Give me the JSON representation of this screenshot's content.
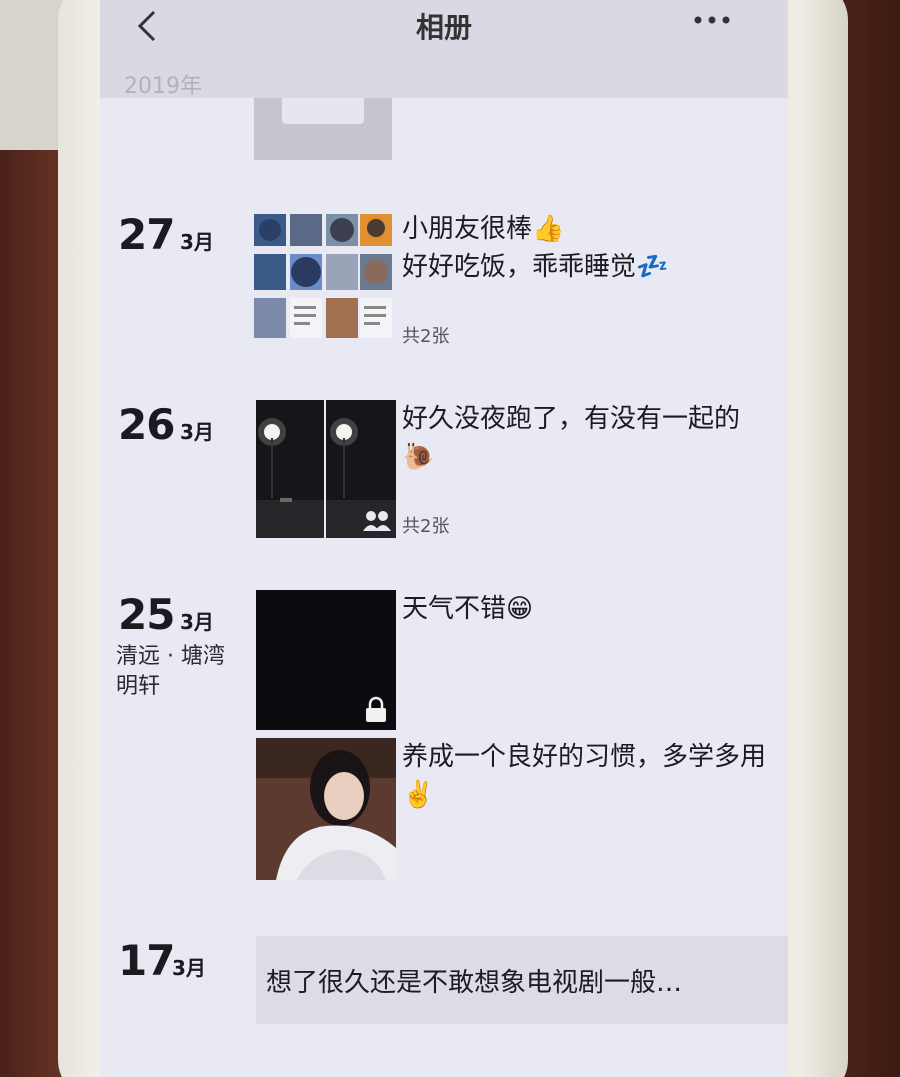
{
  "nav": {
    "back_icon": "chevron-left-icon",
    "title": "相册",
    "more_icon": "more-dots-icon"
  },
  "year_label": "2019年",
  "entries": [
    {
      "day": "27",
      "month": "3月",
      "text": "小朋友很棒👍\n好好吃饭，乖乖睡觉💤",
      "count": "共2张",
      "thumbnail": "photo-grid"
    },
    {
      "day": "26",
      "month": "3月",
      "text": "好久没夜跑了，有没有一起的🐌",
      "count": "共2张",
      "thumbnail": "night-street-photos"
    },
    {
      "day": "25",
      "month": "3月",
      "location": "清远 · 塘湾明轩",
      "posts": [
        {
          "text": "天气不错😁",
          "thumbnail": "dark-photo-locked"
        },
        {
          "text": "养成一个良好的习惯，多学多用✌️",
          "thumbnail": "selfie-photo"
        }
      ]
    },
    {
      "day": "17",
      "month": "3月",
      "text": "想了很久还是不敢想象电视剧一般…"
    }
  ],
  "colors": {
    "screen_bg": "#e9e9f3",
    "nav_bg": "#d9d9e3",
    "text": "#1c1c20",
    "bubble_bg": "#dcdce6"
  }
}
